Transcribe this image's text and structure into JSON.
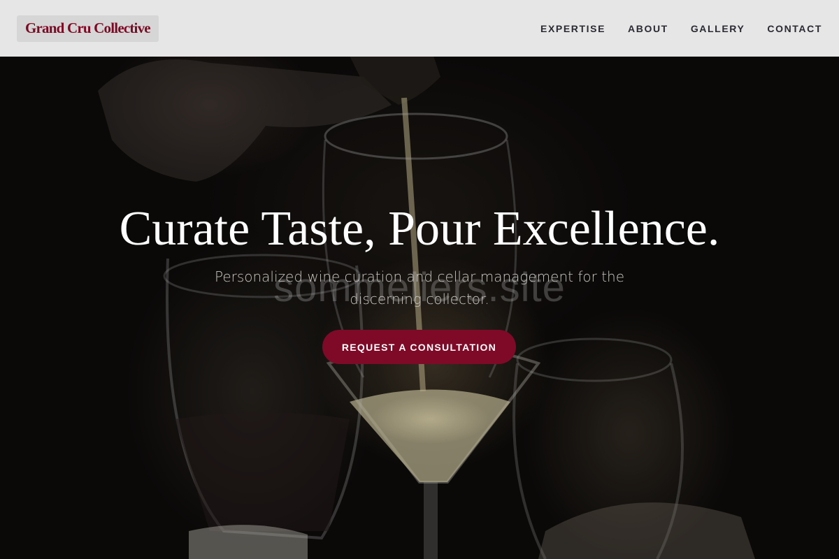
{
  "header": {
    "logo_text": "Grand Cru Collective",
    "nav": [
      {
        "label": "EXPERTISE"
      },
      {
        "label": "ABOUT"
      },
      {
        "label": "GALLERY"
      },
      {
        "label": "CONTACT"
      }
    ]
  },
  "hero": {
    "title": "Curate Taste, Pour Excellence.",
    "subtitle": "Personalized wine curation and cellar management for the discerning collector.",
    "cta_label": "REQUEST A CONSULTATION",
    "watermark": "sommeliers.site"
  },
  "colors": {
    "brand": "#7b0a25",
    "cta_background": "#7e0a28",
    "header_background": "#e6e6e6"
  }
}
